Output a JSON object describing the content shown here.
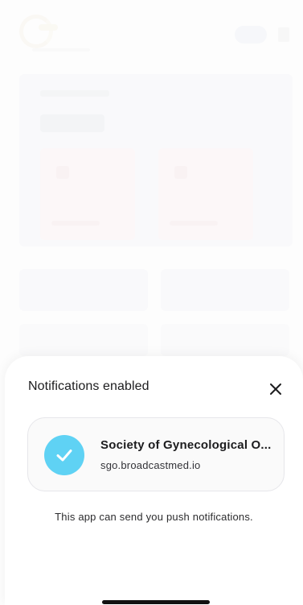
{
  "sheet": {
    "title": "Notifications enabled",
    "close_icon": "close-icon",
    "app": {
      "name": "Society of Gynecological O...",
      "domain": "sgo.broadcastmed.io",
      "status_icon": "checkmark-icon",
      "badge_color": "#5fd2f4"
    },
    "message": "This app can send you push notifications."
  }
}
